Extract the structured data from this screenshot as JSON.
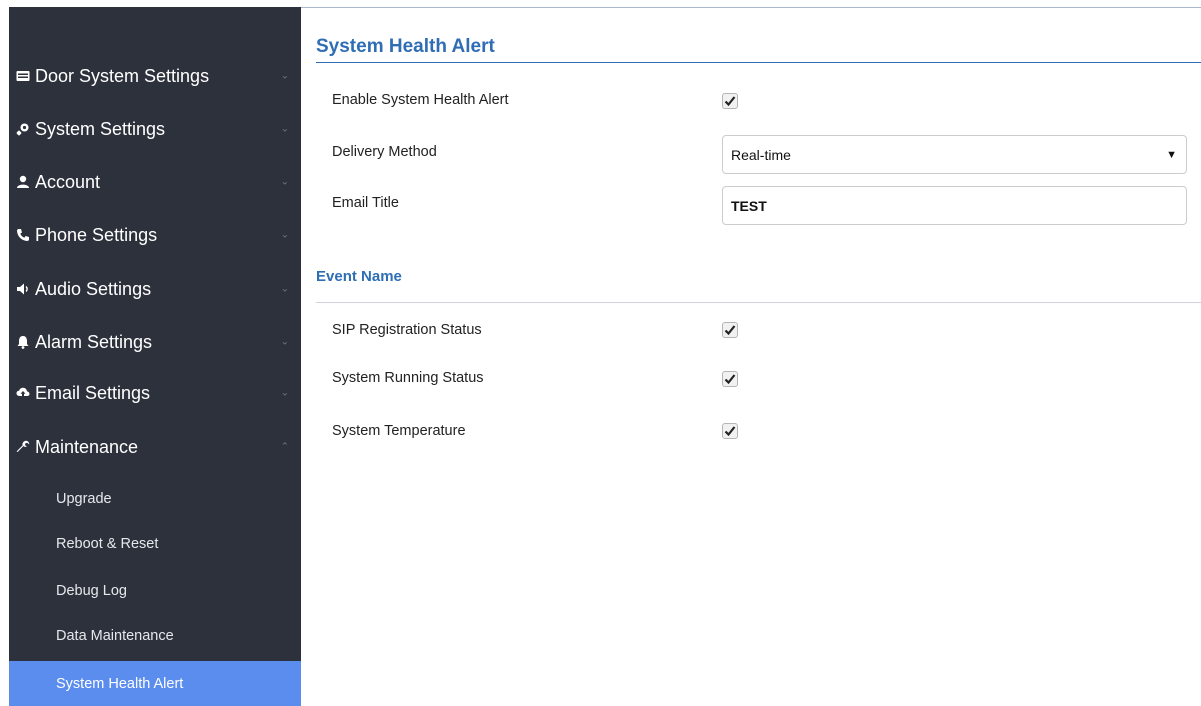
{
  "sidebar": {
    "items": [
      {
        "label": "Door System Settings",
        "icon": "door-system-icon"
      },
      {
        "label": "System Settings",
        "icon": "system-settings-icon"
      },
      {
        "label": "Account",
        "icon": "user-icon"
      },
      {
        "label": "Phone Settings",
        "icon": "phone-icon"
      },
      {
        "label": "Audio Settings",
        "icon": "speaker-icon"
      },
      {
        "label": "Alarm Settings",
        "icon": "bell-icon"
      },
      {
        "label": "Email Settings",
        "icon": "cloud-upload-icon"
      },
      {
        "label": "Maintenance",
        "icon": "wrench-icon"
      }
    ],
    "chevron_collapsed": "⌄",
    "chevron_expanded": "⌃",
    "maintenance_sub": [
      {
        "label": "Upgrade"
      },
      {
        "label": "Reboot & Reset"
      },
      {
        "label": "Debug Log"
      },
      {
        "label": "Data Maintenance"
      },
      {
        "label": "System Health Alert",
        "active": true
      }
    ]
  },
  "main": {
    "title": "System Health Alert",
    "fields": {
      "enable_label": "Enable System Health Alert",
      "enable_checked": true,
      "delivery_label": "Delivery Method",
      "delivery_value": "Real-time",
      "email_title_label": "Email Title",
      "email_title_value": "TEST"
    },
    "event_section_title": "Event Name",
    "events": [
      {
        "label": "SIP Registration Status",
        "checked": true
      },
      {
        "label": "System Running Status",
        "checked": true
      },
      {
        "label": "System Temperature",
        "checked": true
      }
    ]
  },
  "colors": {
    "sidebar_bg": "#2c313c",
    "active_item_bg": "#5b8def",
    "accent": "#2f6eb5"
  }
}
